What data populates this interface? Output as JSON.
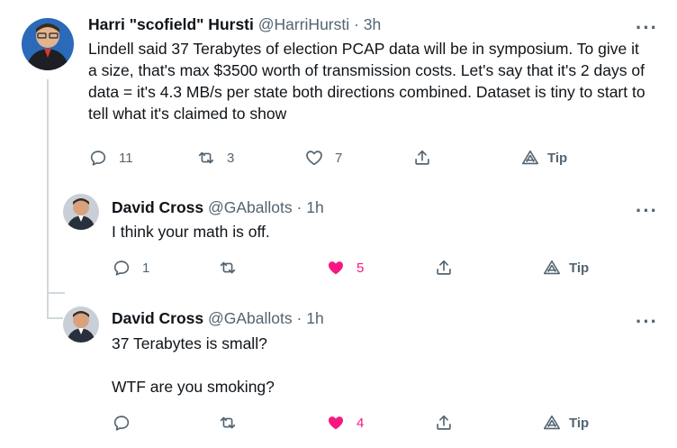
{
  "tweets": [
    {
      "name": "Harri \"scofield\" Hursti",
      "handle": "@HarriHursti",
      "dot": "·",
      "time": "3h",
      "more": "···",
      "text": "Lindell said 37 Terabytes of election PCAP data will be in symposium. To give it a size, that's max $3500 worth of transmission costs. Let's say that it's 2 days of data = it's 4.3 MB/s per state both directions combined. Dataset is tiny to start to tell what it's claimed to show",
      "replies": "11",
      "retweets": "3",
      "likes": "7",
      "tip": "Tip",
      "liked": false
    },
    {
      "name": "David Cross",
      "handle": "@GAballots",
      "dot": "·",
      "time": "1h",
      "more": "···",
      "text": "I think your math is off.",
      "replies": "1",
      "retweets": "",
      "likes": "5",
      "tip": "Tip",
      "liked": true
    },
    {
      "name": "David Cross",
      "handle": "@GAballots",
      "dot": "·",
      "time": "1h",
      "more": "···",
      "text": "37 Terabytes is small?\n\nWTF are you smoking?",
      "replies": "",
      "retweets": "",
      "likes": "4",
      "tip": "Tip",
      "liked": true
    }
  ],
  "colors": {
    "text": "#0f1419",
    "secondary": "#536471",
    "like": "#f91880",
    "thread_line": "#cfd9de"
  }
}
